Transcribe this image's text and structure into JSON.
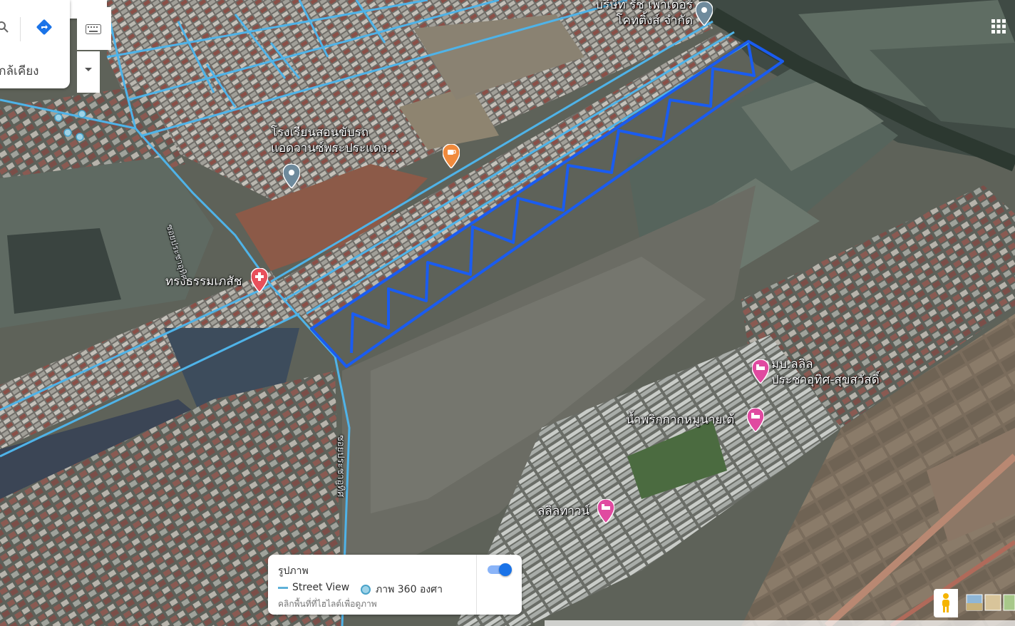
{
  "map": {
    "view": "satellite-3d",
    "accent_color": "#1a5cf0",
    "street_view_color": "#4fb3e8",
    "pois": [
      {
        "id": "company",
        "lines": [
          "บริษัท รัช เพาเดอร์",
          "โคทติ้งส์ จำกัด"
        ],
        "icon": "location-pin-icon",
        "color": "#6e8a9c"
      },
      {
        "id": "school",
        "lines": [
          "โรงเรียนสอนขับรถ",
          "แอดวานซ์พระประแดง..."
        ],
        "icon": "location-pin-icon",
        "color": "#6e8a9c"
      },
      {
        "id": "pharmacy",
        "lines": [
          "ทรงธรรมเภสัช"
        ],
        "icon": "pharmacy-pin-icon",
        "color": "#e8505b"
      },
      {
        "id": "village",
        "lines": [
          "มบ.ลลิล",
          "ประชาอุทิศ-สุขสวัสดิ์"
        ],
        "icon": "lodging-pin-icon",
        "color": "#e04aa0"
      },
      {
        "id": "restaurant",
        "lines": [
          "น้ำพริกกากหมูนายเต้"
        ],
        "icon": "lodging-pin-icon",
        "color": "#e04aa0"
      },
      {
        "id": "lalil",
        "lines": [
          "ลลิลทาวน์"
        ],
        "icon": "lodging-pin-icon",
        "color": "#e04aa0"
      },
      {
        "id": "cafe",
        "lines": [],
        "icon": "cafe-pin-icon",
        "color": "#f08a3c"
      }
    ],
    "road_labels": [
      "ซอยประชาอุทิศ",
      "ซอยประชาอุทิศ"
    ]
  },
  "search": {
    "nearby_label": "ใกล้เคียง",
    "icons": [
      "search-icon",
      "directions-icon",
      "keyboard-icon",
      "dropdown-icon"
    ]
  },
  "photo_layer": {
    "title": "รูปภาพ",
    "street_view_label": "Street View",
    "photo360_label": "ภาพ 360 องศา",
    "hint": "คลิกพื้นที่ที่ไฮไลต์เพื่อดูภาพ",
    "toggle_on": true
  }
}
